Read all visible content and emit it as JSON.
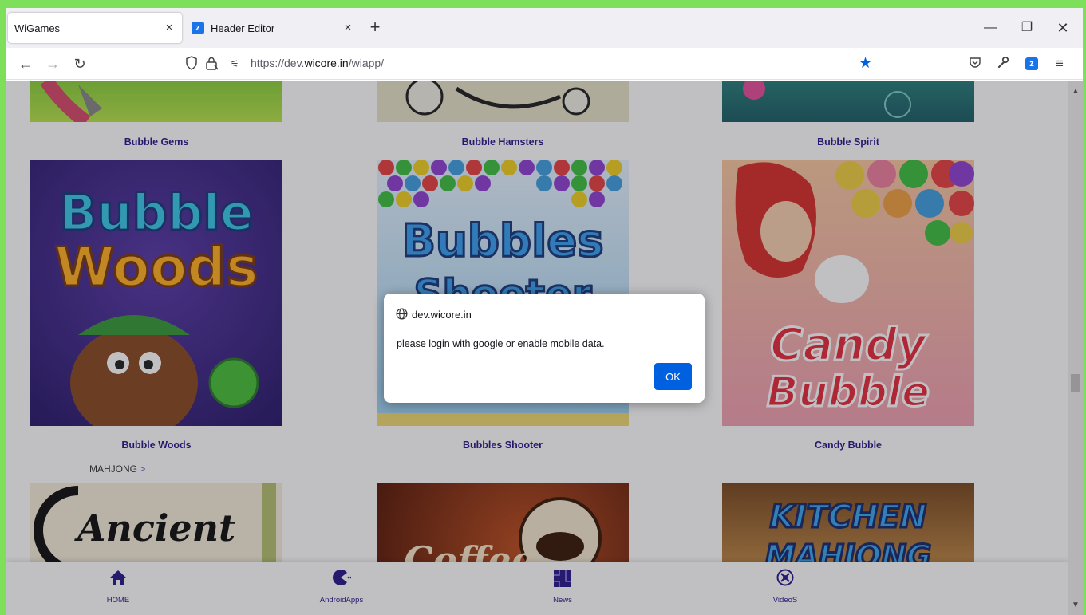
{
  "browser": {
    "tabs": [
      {
        "title": "WiGames",
        "close": "×"
      },
      {
        "title": "Header Editor",
        "close": "×"
      }
    ],
    "new_tab": "+",
    "window_controls": {
      "minimize": "—",
      "maximize": "❐",
      "close": "✕"
    },
    "url": {
      "prefix": "https://dev.",
      "domain": "wicore.in",
      "path": "/wiapp/"
    },
    "icons": [
      "back-icon",
      "forward-icon",
      "reload-icon",
      "shield-icon",
      "lock-icon",
      "permissions-icon",
      "bookmark-star-icon",
      "pocket-icon",
      "wrench-icon",
      "extension-icon",
      "menu-icon"
    ]
  },
  "games": {
    "row1": [
      "Bubble Gems",
      "Bubble Hamsters",
      "Bubble Spirit"
    ],
    "row2": [
      "Bubble Woods",
      "Bubbles Shooter",
      "Candy Bubble"
    ],
    "category": "MAHJONG",
    "category_chevron": ">",
    "thumb_text": {
      "bubble_woods_1": "Bubble",
      "bubble_woods_2": "Woods",
      "bubbles_shooter_1": "Bubbles",
      "bubbles_shooter_2": "Shooter",
      "candy_bubble_1": "Candy",
      "candy_bubble_2": "Bubble",
      "ancient": "Ancient",
      "coffee": "Coffee",
      "kitchen": "KITCHEN",
      "mahjong": "MAHJONG"
    }
  },
  "bottom_nav": [
    {
      "label": "HOME",
      "icon": "home-icon"
    },
    {
      "label": "AndroidApps",
      "icon": "pacman-icon"
    },
    {
      "label": "News",
      "icon": "puzzle-icon"
    },
    {
      "label": "VideoS",
      "icon": "video-icon"
    }
  ],
  "dialog": {
    "origin": "dev.wicore.in",
    "message": "please login with google or enable mobile data.",
    "ok_label": "OK"
  },
  "colors": {
    "accent": "#0061e0",
    "title_text": "#2a1a8a",
    "frame": "#7ee05a"
  }
}
